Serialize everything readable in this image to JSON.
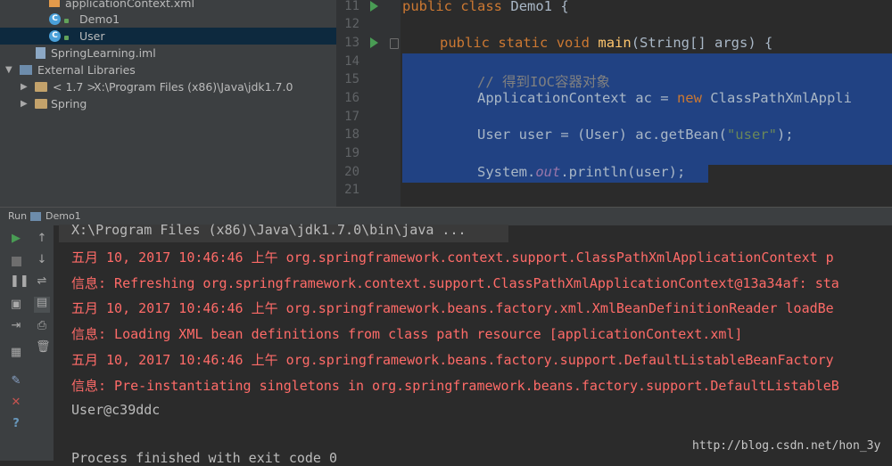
{
  "project_tree": {
    "items": [
      {
        "label": "applicationContext.xml",
        "icon": "xml-file-icon"
      },
      {
        "label": "Demo1",
        "icon": "class-icon"
      },
      {
        "label": "User",
        "icon": "class-icon",
        "selected": true
      },
      {
        "label": "SpringLearning.iml",
        "icon": "iml-file-icon"
      },
      {
        "label": "External Libraries",
        "icon": "libraries-icon",
        "expanded": true
      },
      {
        "label": "< 1.7 >",
        "detail": "X:\\Program Files (x86)\\Java\\jdk1.7.0",
        "icon": "jdk-icon",
        "collapsed": true
      },
      {
        "label": "Spring",
        "icon": "library-icon",
        "collapsed": true
      }
    ]
  },
  "editor": {
    "line_numbers": [
      "11",
      "12",
      "13",
      "14",
      "15",
      "16",
      "17",
      "18",
      "19",
      "20",
      "21"
    ],
    "lines": {
      "l11": {
        "kw1": "public",
        "kw2": "class",
        "name": "Demo1",
        "brace": "{"
      },
      "l13": {
        "kw1": "public",
        "kw2": "static",
        "kw3": "void",
        "fn": "main",
        "rest": "(String[] args) {"
      },
      "l15": "// 得到IOC容器对象",
      "l16": {
        "pre": "ApplicationContext ac = ",
        "kw": "new",
        "post": " ClassPathXmlAppli"
      },
      "l18": {
        "pre": "User user = (User) ac.getBean(",
        "str": "\"user\"",
        "post": ");"
      },
      "l20": {
        "pre": "System.",
        "field": "out",
        "post": ".println(user);"
      }
    }
  },
  "run_panel": {
    "label": "Run",
    "config": "Demo1"
  },
  "console": {
    "lines": [
      {
        "text": "X:\\Program Files (x86)\\Java\\jdk1.7.0\\bin\\java ...",
        "kind": "cmd"
      },
      {
        "text": "五月 10, 2017 10:46:46 上午 org.springframework.context.support.ClassPathXmlApplicationContext p",
        "kind": "err"
      },
      {
        "text": "信息: Refreshing org.springframework.context.support.ClassPathXmlApplicationContext@13a34af: sta",
        "kind": "err"
      },
      {
        "text": "五月 10, 2017 10:46:46 上午 org.springframework.beans.factory.xml.XmlBeanDefinitionReader loadBe",
        "kind": "err"
      },
      {
        "text": "信息: Loading XML bean definitions from class path resource [applicationContext.xml]",
        "kind": "err"
      },
      {
        "text": "五月 10, 2017 10:46:46 上午 org.springframework.beans.factory.support.DefaultListableBeanFactory",
        "kind": "err"
      },
      {
        "text": "信息: Pre-instantiating singletons in org.springframework.beans.factory.support.DefaultListableB",
        "kind": "err"
      },
      {
        "text": "User@c39ddc",
        "kind": "out"
      },
      {
        "text": "",
        "kind": "out"
      },
      {
        "text": "Process finished with exit code 0",
        "kind": "out"
      }
    ]
  },
  "watermark": "http://blog.csdn.net/hon_3y",
  "colors": {
    "keyword": "#cc7832",
    "function": "#ffc66d",
    "string": "#6a8759",
    "comment": "#808080",
    "selection": "#214283",
    "console_error": "#ff6b68"
  }
}
